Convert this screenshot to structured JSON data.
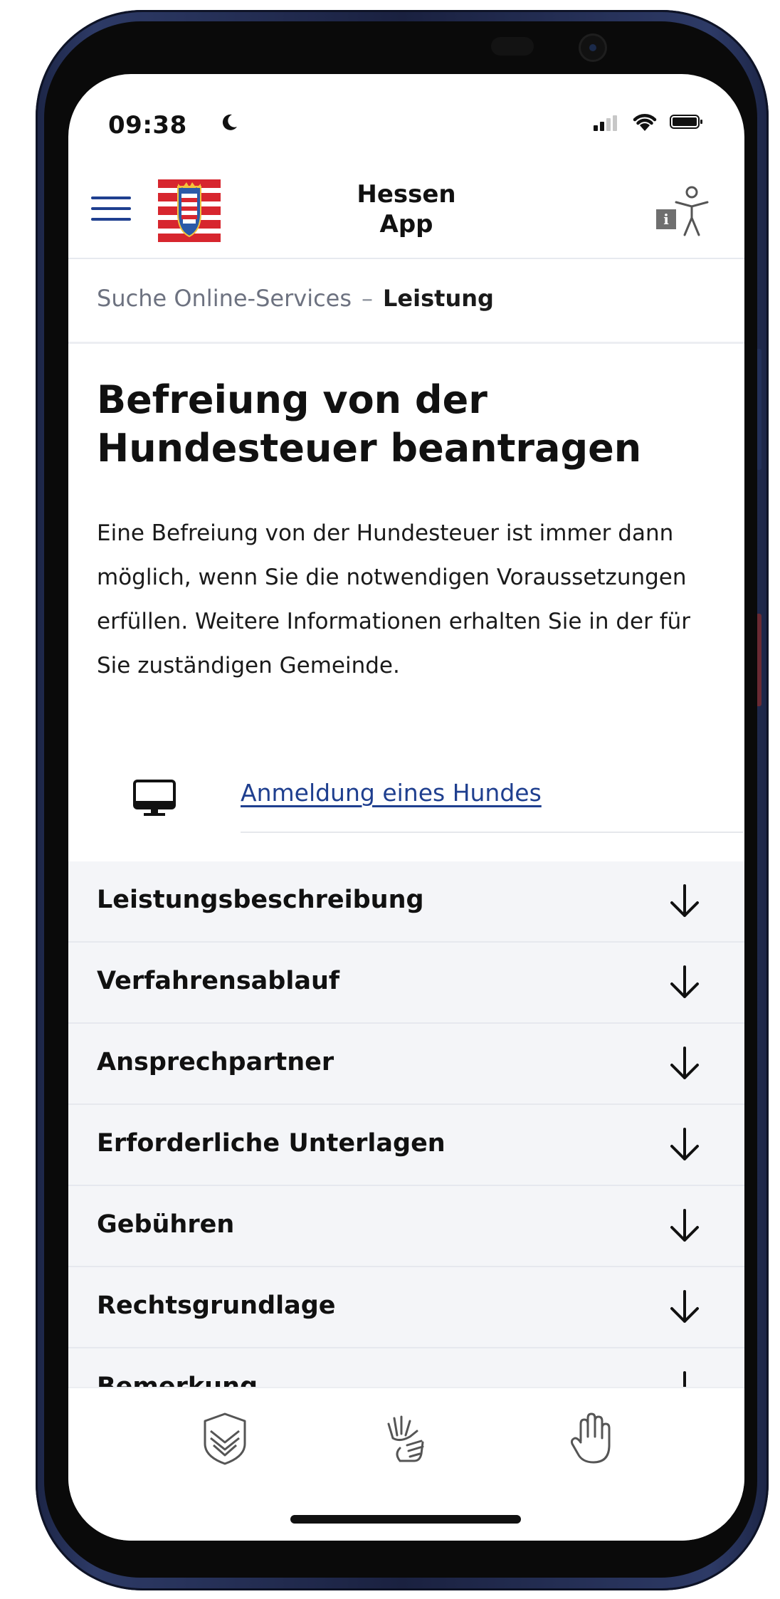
{
  "status_bar": {
    "time": "09:38",
    "icons": [
      "moon-icon",
      "signal-icon",
      "wifi-icon",
      "battery-icon"
    ]
  },
  "header": {
    "menu_icon": "hamburger-icon",
    "logo": "hessen-coat-of-arms",
    "title_line1": "Hessen",
    "title_line2": "App",
    "accessibility_icon": "accessibility-info-icon"
  },
  "breadcrumb": {
    "parent": "Suche Online-Services",
    "separator": "–",
    "current": "Leistung"
  },
  "main": {
    "title": "Befreiung von der Hundesteuer beantragen",
    "description": "Eine Befreiung von der Hundesteuer ist immer dann möglich, wenn Sie die notwendigen Voraussetzungen erfüllen. Weitere Informationen erhalten Sie in der für Sie zuständigen Gemeinde.",
    "link": {
      "icon": "monitor-icon",
      "label": "Anmeldung eines Hundes"
    }
  },
  "accordion": {
    "items": [
      {
        "label": "Leistungsbeschreibung",
        "icon": "arrow-down-icon"
      },
      {
        "label": "Verfahrensablauf",
        "icon": "arrow-down-icon"
      },
      {
        "label": "Ansprechpartner",
        "icon": "arrow-down-icon"
      },
      {
        "label": "Erforderliche Unterlagen",
        "icon": "arrow-down-icon"
      },
      {
        "label": "Gebühren",
        "icon": "arrow-down-icon"
      },
      {
        "label": "Rechtsgrundlage",
        "icon": "arrow-down-icon"
      },
      {
        "label": "Bemerkung",
        "icon": "arrow-down-icon"
      }
    ]
  },
  "bottom_nav": {
    "items": [
      {
        "icon": "shield-book-icon"
      },
      {
        "icon": "sign-language-icon"
      },
      {
        "icon": "hand-icon"
      }
    ]
  },
  "colors": {
    "brand_blue": "#1f3f8f",
    "accordion_bg": "#f4f5f8",
    "flag_red": "#d7262e",
    "flag_blue": "#2b5aa8"
  }
}
